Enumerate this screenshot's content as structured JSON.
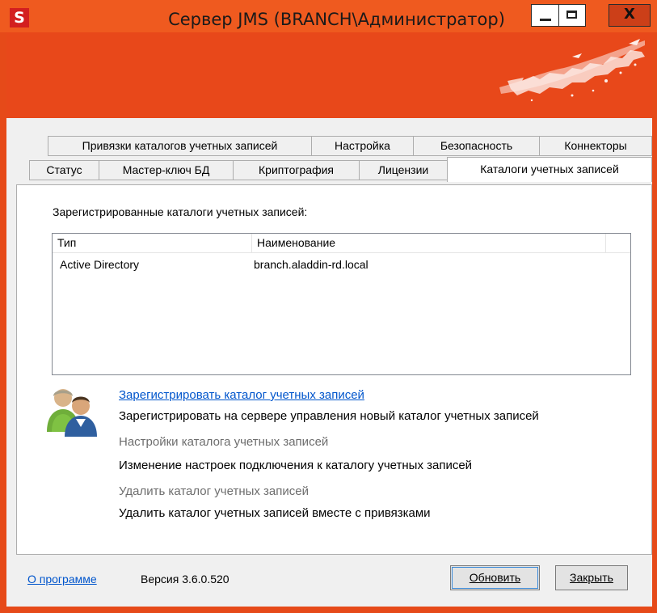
{
  "window": {
    "app_icon_letter": "S",
    "title": "Сервер JMS (BRANCH\\Администратор)",
    "close_glyph": "X"
  },
  "tabs_top": [
    {
      "label": "Привязки каталогов учетных записей"
    },
    {
      "label": "Настройка"
    },
    {
      "label": "Безопасность"
    },
    {
      "label": "Коннекторы"
    }
  ],
  "tabs_bottom": [
    {
      "label": "Статус"
    },
    {
      "label": "Мастер-ключ БД"
    },
    {
      "label": "Криптография"
    },
    {
      "label": "Лицензии"
    },
    {
      "label": "Каталоги учетных записей",
      "active": true
    }
  ],
  "main": {
    "registered_label": "Зарегистрированные каталоги учетных записей:",
    "list": {
      "columns": [
        "Тип",
        "Наименование"
      ],
      "rows": [
        {
          "type": "Active Directory",
          "name": "branch.aladdin-rd.local"
        }
      ]
    },
    "actions": {
      "register_link": "Зарегистрировать каталог учетных записей",
      "register_desc": "Зарегистрировать на сервере управления новый каталог учетных записей",
      "settings_link": "Настройки каталога учетных записей",
      "settings_desc": "Изменение настроек подключения к каталогу учетных записей",
      "delete_link": "Удалить каталог учетных записей",
      "delete_desc": "Удалить каталог учетных записей вместе с привязками"
    }
  },
  "footer": {
    "about_link": "О программе",
    "version": "Версия 3.6.0.520",
    "refresh_button": "Обновить",
    "close_button": "Закрыть"
  },
  "colors": {
    "banner": "#e8481a",
    "link": "#0055cc",
    "disabled_text": "#6d6d6d"
  },
  "icons": [
    "app-logo-icon",
    "minimize-icon",
    "maximize-icon",
    "close-icon",
    "users-icon"
  ]
}
